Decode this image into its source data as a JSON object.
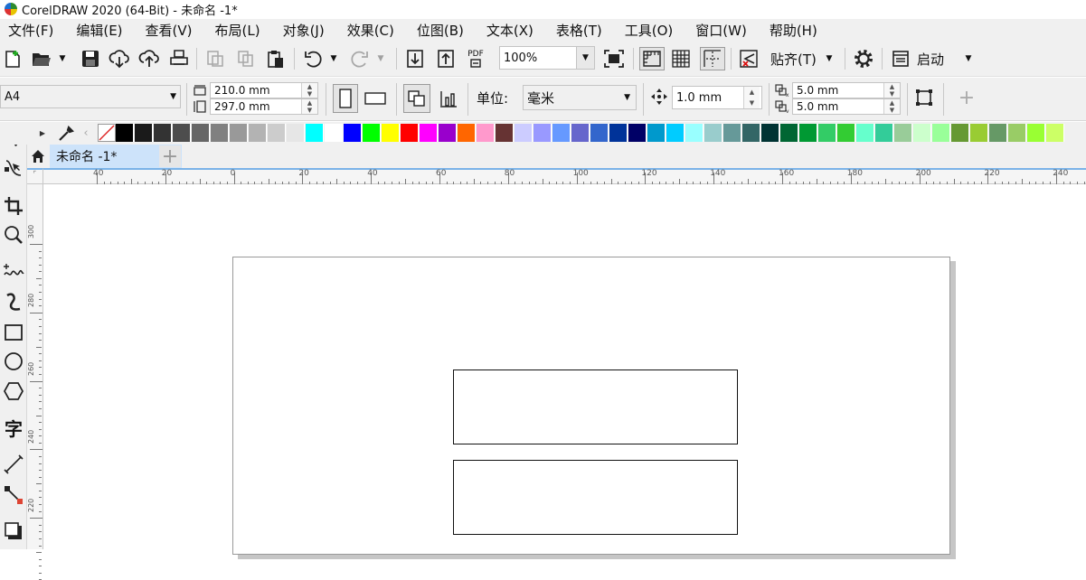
{
  "window": {
    "title": "CorelDRAW 2020 (64-Bit) - 未命名 -1*"
  },
  "menu": [
    "文件(F)",
    "编辑(E)",
    "查看(V)",
    "布局(L)",
    "对象(J)",
    "效果(C)",
    "位图(B)",
    "文本(X)",
    "表格(T)",
    "工具(O)",
    "窗口(W)",
    "帮助(H)"
  ],
  "toolbar": {
    "pdf_label": "PDF",
    "zoom": "100%",
    "snap_label": "贴齐(T)",
    "launch_label": "启动"
  },
  "propbar": {
    "page_size": "A4",
    "width": "210.0 mm",
    "height": "297.0 mm",
    "units_label": "单位:",
    "units": "毫米",
    "nudge": "1.0 mm",
    "dup_x": "5.0 mm",
    "dup_y": "5.0 mm"
  },
  "palette": [
    "#000000",
    "#1a1a1a",
    "#333333",
    "#4d4d4d",
    "#666666",
    "#808080",
    "#999999",
    "#b3b3b3",
    "#cccccc",
    "#e6e6e6",
    "#00ffff",
    "#ffffff",
    "#0000ff",
    "#00ff00",
    "#ffff00",
    "#ff0000",
    "#ff00ff",
    "#9900cc",
    "#ff6600",
    "#ff99cc",
    "#663333",
    "#ccccff",
    "#9999ff",
    "#6699ff",
    "#6666cc",
    "#3366cc",
    "#003399",
    "#000066",
    "#0099cc",
    "#00ccff",
    "#99ffff",
    "#99cccc",
    "#669999",
    "#336666",
    "#003333",
    "#006633",
    "#009933",
    "#33cc66",
    "#33cc33",
    "#66ffcc",
    "#33cc99",
    "#99cc99",
    "#ccffcc",
    "#99ff99",
    "#669933",
    "#99cc33",
    "#669966",
    "#99cc66",
    "#99ff33",
    "#ccff66"
  ],
  "document": {
    "tab": "未命名 -1*"
  },
  "ruler": {
    "h_labels": [
      "40",
      "20",
      "0",
      "20",
      "40",
      "60",
      "80",
      "100",
      "120",
      "140",
      "160",
      "180",
      "200",
      "220",
      "240"
    ],
    "v_labels": [
      "300",
      "280",
      "260",
      "240",
      "220"
    ]
  }
}
